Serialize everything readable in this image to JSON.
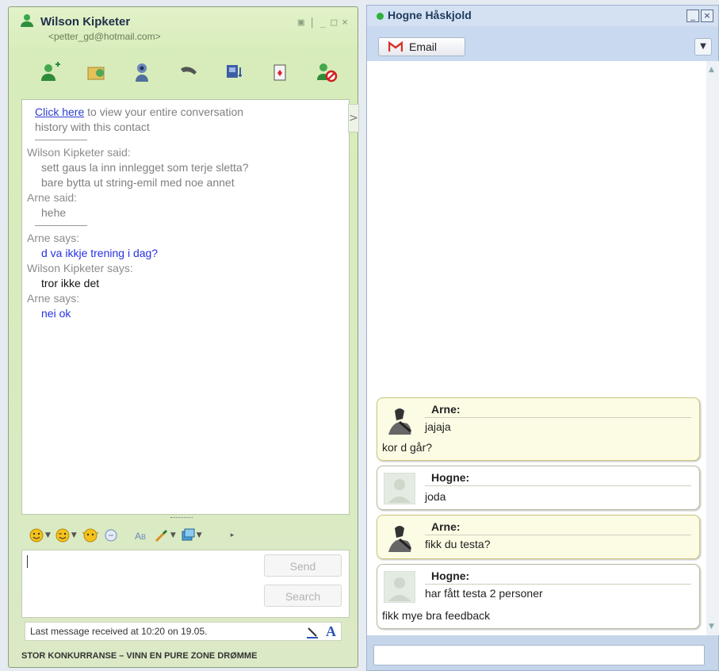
{
  "msn": {
    "contact_name": "Wilson Kipketer",
    "contact_email": "<petter_gd@hotmail.com>",
    "window_controls": [
      "▣",
      "|",
      "_",
      "□",
      "×"
    ],
    "history_link_text": "Click here",
    "history_link_rest": " to view your entire conversation",
    "history_link_line2": "history with this contact",
    "old_messages": [
      {
        "name": "Wilson Kipketer said:",
        "lines": [
          "sett gaus la inn innlegget som terje sletta?",
          "bare bytta ut string-emil med noe annet"
        ]
      },
      {
        "name": "Arne said:",
        "lines": [
          "hehe"
        ]
      }
    ],
    "new_messages": [
      {
        "name": "Arne says:",
        "text": "d va ikkje trening i dag?",
        "style": "blue"
      },
      {
        "name": "Wilson Kipketer says:",
        "text": "tror ikke det",
        "style": "black"
      },
      {
        "name": "Arne says:",
        "text": "nei ok",
        "style": "blue"
      }
    ],
    "send_label": "Send",
    "search_label": "Search",
    "status_text": "Last message received at 10:20 on 19.05.",
    "format_a": "A",
    "ad_text": "STOR KONKURRANSE – VINN EN PURE ZONE DRØMME",
    "toolbar_icons": [
      "invite-contact-icon",
      "send-files-icon",
      "webcam-icon",
      "call-icon",
      "activities-icon",
      "games-icon",
      "block-icon"
    ],
    "history_toggle": ">"
  },
  "gchat": {
    "contact_name": "Hogne Håskjold",
    "status_color": "#2fb13b",
    "email_button": "Email",
    "dropdown": "▼",
    "window_controls": [
      "_",
      "×"
    ],
    "messages": [
      {
        "name": "Arne:",
        "line1": "jajaja",
        "line2": "kor d går?",
        "style": "yellow",
        "avatar": "photo"
      },
      {
        "name": "Hogne:",
        "line1": "joda",
        "line2": "",
        "style": "white",
        "avatar": "placeholder"
      },
      {
        "name": "Arne:",
        "line1": "fikk du testa?",
        "line2": "",
        "style": "yellow",
        "avatar": "photo"
      },
      {
        "name": "Hogne:",
        "line1": "har fått testa 2 personer",
        "line2": "fikk mye bra feedback",
        "style": "white",
        "avatar": "placeholder"
      }
    ]
  }
}
